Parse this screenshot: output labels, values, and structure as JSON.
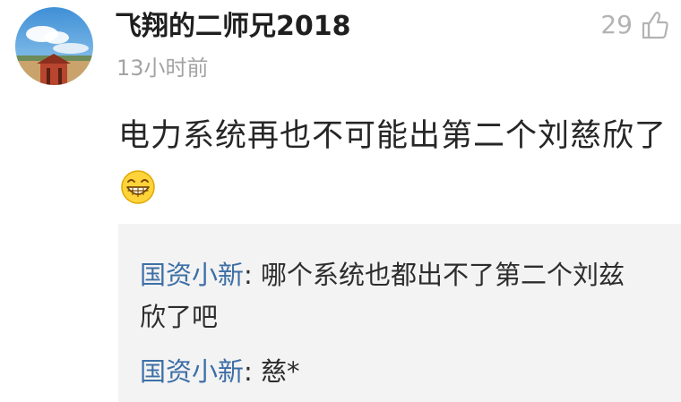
{
  "comment": {
    "username": "飞翔的二师兄2018",
    "time": "13小时前",
    "like_count": "29",
    "text": "电力系统再也不可能出第二个刘慈欣了",
    "emoji": "grinning-face-icon"
  },
  "replies": [
    {
      "author": "国资小新",
      "separator": ": ",
      "text": "哪个系统也都出不了第二个刘兹欣了吧"
    },
    {
      "author": "国资小新",
      "separator": ": ",
      "text": "慈*"
    }
  ],
  "colors": {
    "link_author": "#3d6fa6",
    "muted": "#a3a3a3",
    "reply_bg": "#f3f3f3"
  }
}
